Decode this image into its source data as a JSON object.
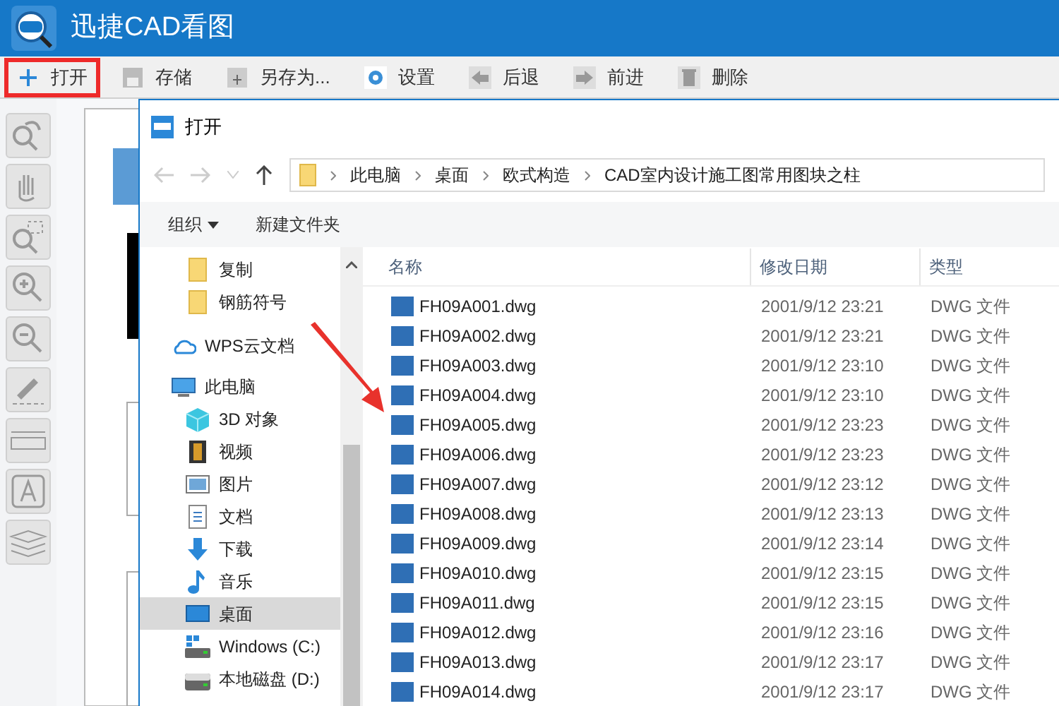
{
  "app": {
    "title": "迅捷CAD看图"
  },
  "toolbar": [
    {
      "kind": "open",
      "label": "打开",
      "highlighted": true
    },
    {
      "kind": "save",
      "label": "存储",
      "highlighted": false
    },
    {
      "kind": "saveas",
      "label": "另存为...",
      "highlighted": false
    },
    {
      "kind": "settings",
      "label": "设置",
      "highlighted": false
    },
    {
      "kind": "back",
      "label": "后退",
      "highlighted": false
    },
    {
      "kind": "forward",
      "label": "前进",
      "highlighted": false
    },
    {
      "kind": "delete",
      "label": "删除",
      "highlighted": false
    }
  ],
  "dialog": {
    "title": "打开",
    "breadcrumb": [
      "此电脑",
      "桌面",
      "欧式构造",
      "CAD室内设计施工图常用图块之柱"
    ],
    "commands": [
      {
        "kind": "menu",
        "label": "组织"
      },
      {
        "kind": "plain",
        "label": "新建文件夹"
      }
    ],
    "nav": [
      {
        "kind": "folder",
        "label": "复制",
        "selected": false
      },
      {
        "kind": "folder",
        "label": "钢筋符号",
        "selected": false
      },
      {
        "kind": "cloud",
        "label": "WPS云文档",
        "selected": false
      },
      {
        "kind": "pc",
        "label": "此电脑",
        "selected": false
      },
      {
        "kind": "cube",
        "label": "3D 对象",
        "selected": false
      },
      {
        "kind": "video",
        "label": "视频",
        "selected": false
      },
      {
        "kind": "image",
        "label": "图片",
        "selected": false
      },
      {
        "kind": "doc",
        "label": "文档",
        "selected": false
      },
      {
        "kind": "download",
        "label": "下载",
        "selected": false
      },
      {
        "kind": "music",
        "label": "音乐",
        "selected": false
      },
      {
        "kind": "desktop",
        "label": "桌面",
        "selected": true
      },
      {
        "kind": "windrive",
        "label": "Windows (C:)",
        "selected": false
      },
      {
        "kind": "drive",
        "label": "本地磁盘 (D:)",
        "selected": false
      }
    ],
    "columns": [
      "名称",
      "修改日期",
      "类型"
    ],
    "files": [
      {
        "name": "FH09A001.dwg",
        "date": "2001/9/12 23:21",
        "type": "DWG 文件"
      },
      {
        "name": "FH09A002.dwg",
        "date": "2001/9/12 23:21",
        "type": "DWG 文件"
      },
      {
        "name": "FH09A003.dwg",
        "date": "2001/9/12 23:10",
        "type": "DWG 文件"
      },
      {
        "name": "FH09A004.dwg",
        "date": "2001/9/12 23:10",
        "type": "DWG 文件"
      },
      {
        "name": "FH09A005.dwg",
        "date": "2001/9/12 23:23",
        "type": "DWG 文件"
      },
      {
        "name": "FH09A006.dwg",
        "date": "2001/9/12 23:23",
        "type": "DWG 文件"
      },
      {
        "name": "FH09A007.dwg",
        "date": "2001/9/12 23:12",
        "type": "DWG 文件"
      },
      {
        "name": "FH09A008.dwg",
        "date": "2001/9/12 23:13",
        "type": "DWG 文件"
      },
      {
        "name": "FH09A009.dwg",
        "date": "2001/9/12 23:14",
        "type": "DWG 文件"
      },
      {
        "name": "FH09A010.dwg",
        "date": "2001/9/12 23:15",
        "type": "DWG 文件"
      },
      {
        "name": "FH09A011.dwg",
        "date": "2001/9/12 23:15",
        "type": "DWG 文件"
      },
      {
        "name": "FH09A012.dwg",
        "date": "2001/9/12 23:16",
        "type": "DWG 文件"
      },
      {
        "name": "FH09A013.dwg",
        "date": "2001/9/12 23:17",
        "type": "DWG 文件"
      },
      {
        "name": "FH09A014.dwg",
        "date": "2001/9/12 23:17",
        "type": "DWG 文件"
      }
    ]
  }
}
